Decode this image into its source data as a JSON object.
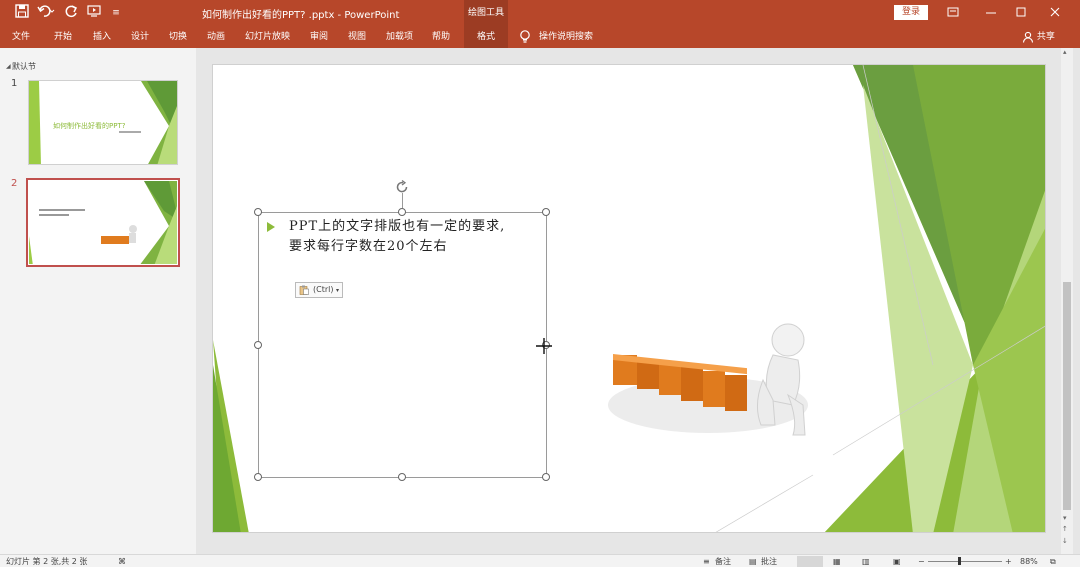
{
  "quick_access": {
    "save_icon": "save-icon",
    "undo_icon": "undo-icon",
    "redo_icon": "redo-icon",
    "start_from_beginning_icon": "start-slideshow-icon",
    "customize_icon": "customize-qat-icon"
  },
  "window": {
    "title": "如何制作出好看的PPT? .pptx  -  PowerPoint",
    "contextual_group": "绘图工具",
    "login_label": "登录"
  },
  "ribbon": {
    "tabs": [
      {
        "label": "文件"
      },
      {
        "label": "开始"
      },
      {
        "label": "插入"
      },
      {
        "label": "设计"
      },
      {
        "label": "切换"
      },
      {
        "label": "动画"
      },
      {
        "label": "幻灯片放映"
      },
      {
        "label": "审阅"
      },
      {
        "label": "视图"
      },
      {
        "label": "加载项"
      },
      {
        "label": "帮助"
      }
    ],
    "active_tab": "格式",
    "tell_me": "操作说明搜索",
    "share": "共享"
  },
  "thumbnails": {
    "section": "默认节",
    "slides": [
      {
        "number": "1",
        "text": "如何制作出好看的PPT?"
      },
      {
        "number": "2",
        "text": ""
      }
    ]
  },
  "slide": {
    "bullet_lines": [
      "PPT上的文字排版也有一定的要求,",
      "要求每行字数在20个左右"
    ],
    "paste_options": "(Ctrl)"
  },
  "status": {
    "slide_info": "幻灯片 第 2 张,共 2 张",
    "notes": "备注",
    "comments": "批注",
    "zoom": "88%"
  },
  "colors": {
    "ribbon": "#b7472a",
    "accent_green": "#8dbb3a",
    "thumbnail_selected": "#c0504d"
  }
}
